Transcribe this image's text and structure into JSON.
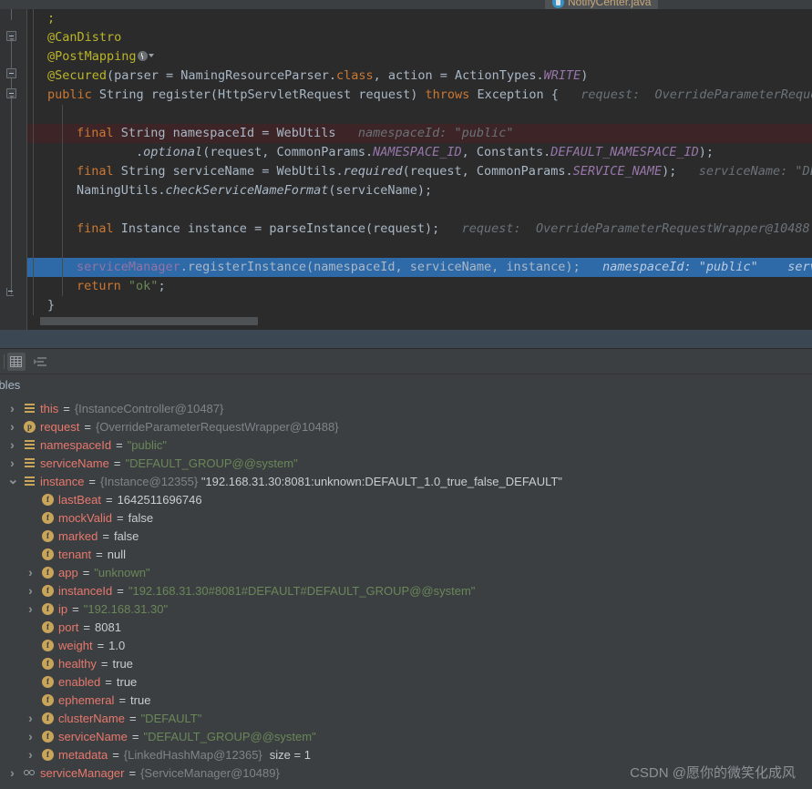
{
  "window": {
    "theme_bg": "#2b2b2b",
    "accent_selection": "#2f6aa8"
  },
  "editor_tab": {
    "label": "NotifyCenter.java",
    "icon": "java-class-icon"
  },
  "editor": {
    "scrollbar": "horizontal-scrollbar",
    "lines": [
      {
        "id": "l0",
        "fragments": [
          {
            "t": ";",
            "c": "ann"
          }
        ],
        "indent": 1,
        "state": "normal"
      },
      {
        "id": "l1",
        "fragments": [
          {
            "t": "@CanDistro",
            "c": "ann"
          }
        ],
        "indent": 1,
        "state": "normal"
      },
      {
        "id": "l2",
        "fragments": [
          {
            "t": "@PostMapping",
            "c": "ann"
          }
        ],
        "indent": 1,
        "state": "normal",
        "trailing_icon": "gutter-mapping-icon"
      },
      {
        "id": "l3",
        "fragments": [
          {
            "t": "@Secured",
            "c": "ann"
          },
          {
            "t": "(parser = NamingResourceParser.",
            "c": "op"
          },
          {
            "t": "class",
            "c": "kw"
          },
          {
            "t": ", action = ActionTypes.",
            "c": "op"
          },
          {
            "t": "WRITE",
            "c": "stat"
          },
          {
            "t": ")",
            "c": "op"
          }
        ],
        "indent": 1,
        "state": "normal"
      },
      {
        "id": "l4",
        "fragments": [
          {
            "t": "public",
            "c": "kw"
          },
          {
            "t": " String ",
            "c": "type"
          },
          {
            "t": "register",
            "c": "fn"
          },
          {
            "t": "(HttpServletRequest request) ",
            "c": "op"
          },
          {
            "t": "throws",
            "c": "kw"
          },
          {
            "t": " Exception {",
            "c": "op"
          },
          {
            "t": "   request:  OverrideParameterRequestW",
            "c": "hint"
          }
        ],
        "indent": 1,
        "state": "normal"
      },
      {
        "id": "l5",
        "fragments": [],
        "indent": 2,
        "state": "normal"
      },
      {
        "id": "l6",
        "fragments": [
          {
            "t": "final",
            "c": "kw"
          },
          {
            "t": " String namespaceId = WebUtils",
            "c": "op"
          },
          {
            "t": "   namespaceId: \"public\"",
            "c": "hint"
          }
        ],
        "indent": 2,
        "state": "error"
      },
      {
        "id": "l7",
        "fragments": [
          {
            "t": "        .",
            "c": "op"
          },
          {
            "t": "optional",
            "c": "fni"
          },
          {
            "t": "(request, CommonParams.",
            "c": "op"
          },
          {
            "t": "NAMESPACE_ID",
            "c": "stat"
          },
          {
            "t": ", Constants.",
            "c": "op"
          },
          {
            "t": "DEFAULT_NAMESPACE_ID",
            "c": "stat"
          },
          {
            "t": ");",
            "c": "op"
          }
        ],
        "indent": 2,
        "state": "normal"
      },
      {
        "id": "l8",
        "fragments": [
          {
            "t": "final",
            "c": "kw"
          },
          {
            "t": " String serviceName = WebUtils.",
            "c": "op"
          },
          {
            "t": "required",
            "c": "fni"
          },
          {
            "t": "(request, CommonParams.",
            "c": "op"
          },
          {
            "t": "SERVICE_NAME",
            "c": "stat"
          },
          {
            "t": ");",
            "c": "op"
          },
          {
            "t": "   serviceName: \"DEFA",
            "c": "hint"
          }
        ],
        "indent": 2,
        "state": "normal"
      },
      {
        "id": "l9",
        "fragments": [
          {
            "t": "NamingUtils.",
            "c": "op"
          },
          {
            "t": "checkServiceNameFormat",
            "c": "fni"
          },
          {
            "t": "(serviceName);",
            "c": "op"
          }
        ],
        "indent": 2,
        "state": "normal"
      },
      {
        "id": "l10",
        "fragments": [],
        "indent": 2,
        "state": "normal"
      },
      {
        "id": "l11",
        "fragments": [
          {
            "t": "final",
            "c": "kw"
          },
          {
            "t": " Instance instance = ",
            "c": "op"
          },
          {
            "t": "parseInstance",
            "c": "fn"
          },
          {
            "t": "(request);",
            "c": "op"
          },
          {
            "t": "   request:  OverrideParameterRequestWrapper@10488",
            "c": "hint"
          }
        ],
        "indent": 2,
        "state": "normal"
      },
      {
        "id": "l12",
        "fragments": [],
        "indent": 2,
        "state": "normal"
      },
      {
        "id": "l13",
        "fragments": [
          {
            "t": "serviceManager",
            "c": "inst"
          },
          {
            "t": ".registerInstance(namespaceId, serviceName, instance);",
            "c": "op"
          },
          {
            "t": "   namespaceId: \"public\"    servic",
            "c": "hint"
          }
        ],
        "indent": 2,
        "state": "selected"
      },
      {
        "id": "l14",
        "fragments": [
          {
            "t": "return",
            "c": "kw"
          },
          {
            "t": " ",
            "c": "op"
          },
          {
            "t": "\"ok\"",
            "c": "str"
          },
          {
            "t": ";",
            "c": "op"
          }
        ],
        "indent": 2,
        "state": "normal"
      },
      {
        "id": "l15",
        "fragments": [
          {
            "t": "}",
            "c": "op"
          }
        ],
        "indent": 1,
        "state": "normal"
      }
    ]
  },
  "debugger": {
    "toolbar": {
      "buttons": [
        {
          "name": "show-types-button",
          "icon": "grid-icon",
          "active": true
        },
        {
          "name": "sort-values-button",
          "icon": "list-icon",
          "active": false
        }
      ]
    },
    "variables_tab_label": "riables",
    "variables": [
      {
        "indent": 0,
        "expander": "collapsed",
        "icon": "local",
        "icon_letter": "",
        "name": "this",
        "eq": "=",
        "value": "{InstanceController@10487}",
        "value_kind": "ref"
      },
      {
        "indent": 0,
        "expander": "collapsed",
        "icon": "circle",
        "icon_letter": "p",
        "name": "request",
        "eq": "=",
        "value": "{OverrideParameterRequestWrapper@10488}",
        "value_kind": "ref"
      },
      {
        "indent": 0,
        "expander": "collapsed",
        "icon": "local",
        "icon_letter": "",
        "name": "namespaceId",
        "eq": "=",
        "value": "\"public\"",
        "value_kind": "str"
      },
      {
        "indent": 0,
        "expander": "collapsed",
        "icon": "local",
        "icon_letter": "",
        "name": "serviceName",
        "eq": "=",
        "value": "\"DEFAULT_GROUP@@system\"",
        "value_kind": "str"
      },
      {
        "indent": 0,
        "expander": "expanded",
        "icon": "local",
        "icon_letter": "",
        "name": "instance",
        "eq": "=",
        "value": "{Instance@12355}",
        "value_kind": "ref",
        "value2": "\"192.168.31.30:8081:unknown:DEFAULT_1.0_true_false_DEFAULT\"",
        "value2_kind": "text"
      },
      {
        "indent": 1,
        "expander": "none",
        "icon": "circle",
        "icon_letter": "f",
        "name": "lastBeat",
        "eq": "=",
        "value": "1642511696746",
        "value_kind": "num"
      },
      {
        "indent": 1,
        "expander": "none",
        "icon": "circle",
        "icon_letter": "f",
        "name": "mockValid",
        "eq": "=",
        "value": "false",
        "value_kind": "bool"
      },
      {
        "indent": 1,
        "expander": "none",
        "icon": "circle",
        "icon_letter": "f",
        "name": "marked",
        "eq": "=",
        "value": "false",
        "value_kind": "bool"
      },
      {
        "indent": 1,
        "expander": "none",
        "icon": "circle",
        "icon_letter": "f",
        "name": "tenant",
        "eq": "=",
        "value": "null",
        "value_kind": "bool"
      },
      {
        "indent": 1,
        "expander": "collapsed",
        "icon": "circle",
        "icon_letter": "f",
        "name": "app",
        "eq": "=",
        "value": "\"unknown\"",
        "value_kind": "str"
      },
      {
        "indent": 1,
        "expander": "collapsed",
        "icon": "circle",
        "icon_letter": "f",
        "name": "instanceId",
        "eq": "=",
        "value": "\"192.168.31.30#8081#DEFAULT#DEFAULT_GROUP@@system\"",
        "value_kind": "str"
      },
      {
        "indent": 1,
        "expander": "collapsed",
        "icon": "circle",
        "icon_letter": "f",
        "name": "ip",
        "eq": "=",
        "value": "\"192.168.31.30\"",
        "value_kind": "str"
      },
      {
        "indent": 1,
        "expander": "none",
        "icon": "circle",
        "icon_letter": "f",
        "name": "port",
        "eq": "=",
        "value": "8081",
        "value_kind": "num"
      },
      {
        "indent": 1,
        "expander": "none",
        "icon": "circle",
        "icon_letter": "f",
        "name": "weight",
        "eq": "=",
        "value": "1.0",
        "value_kind": "num"
      },
      {
        "indent": 1,
        "expander": "none",
        "icon": "circle",
        "icon_letter": "f",
        "name": "healthy",
        "eq": "=",
        "value": "true",
        "value_kind": "bool"
      },
      {
        "indent": 1,
        "expander": "none",
        "icon": "circle",
        "icon_letter": "f",
        "name": "enabled",
        "eq": "=",
        "value": "true",
        "value_kind": "bool"
      },
      {
        "indent": 1,
        "expander": "none",
        "icon": "circle",
        "icon_letter": "f",
        "name": "ephemeral",
        "eq": "=",
        "value": "true",
        "value_kind": "bool"
      },
      {
        "indent": 1,
        "expander": "collapsed",
        "icon": "circle",
        "icon_letter": "f",
        "name": "clusterName",
        "eq": "=",
        "value": "\"DEFAULT\"",
        "value_kind": "str"
      },
      {
        "indent": 1,
        "expander": "collapsed",
        "icon": "circle",
        "icon_letter": "f",
        "name": "serviceName",
        "eq": "=",
        "value": "\"DEFAULT_GROUP@@system\"",
        "value_kind": "str"
      },
      {
        "indent": 1,
        "expander": "collapsed",
        "icon": "circle",
        "icon_letter": "f",
        "name": "metadata",
        "eq": "=",
        "value": "{LinkedHashMap@12365}",
        "value_kind": "ref",
        "extra": "size = 1"
      },
      {
        "indent": 0,
        "expander": "collapsed",
        "icon": "glasses",
        "icon_letter": "",
        "name": "serviceManager",
        "eq": "=",
        "value": "{ServiceManager@10489}",
        "value_kind": "ref"
      }
    ]
  },
  "watermark": {
    "text": "CSDN @愿你的微笑化成风"
  }
}
